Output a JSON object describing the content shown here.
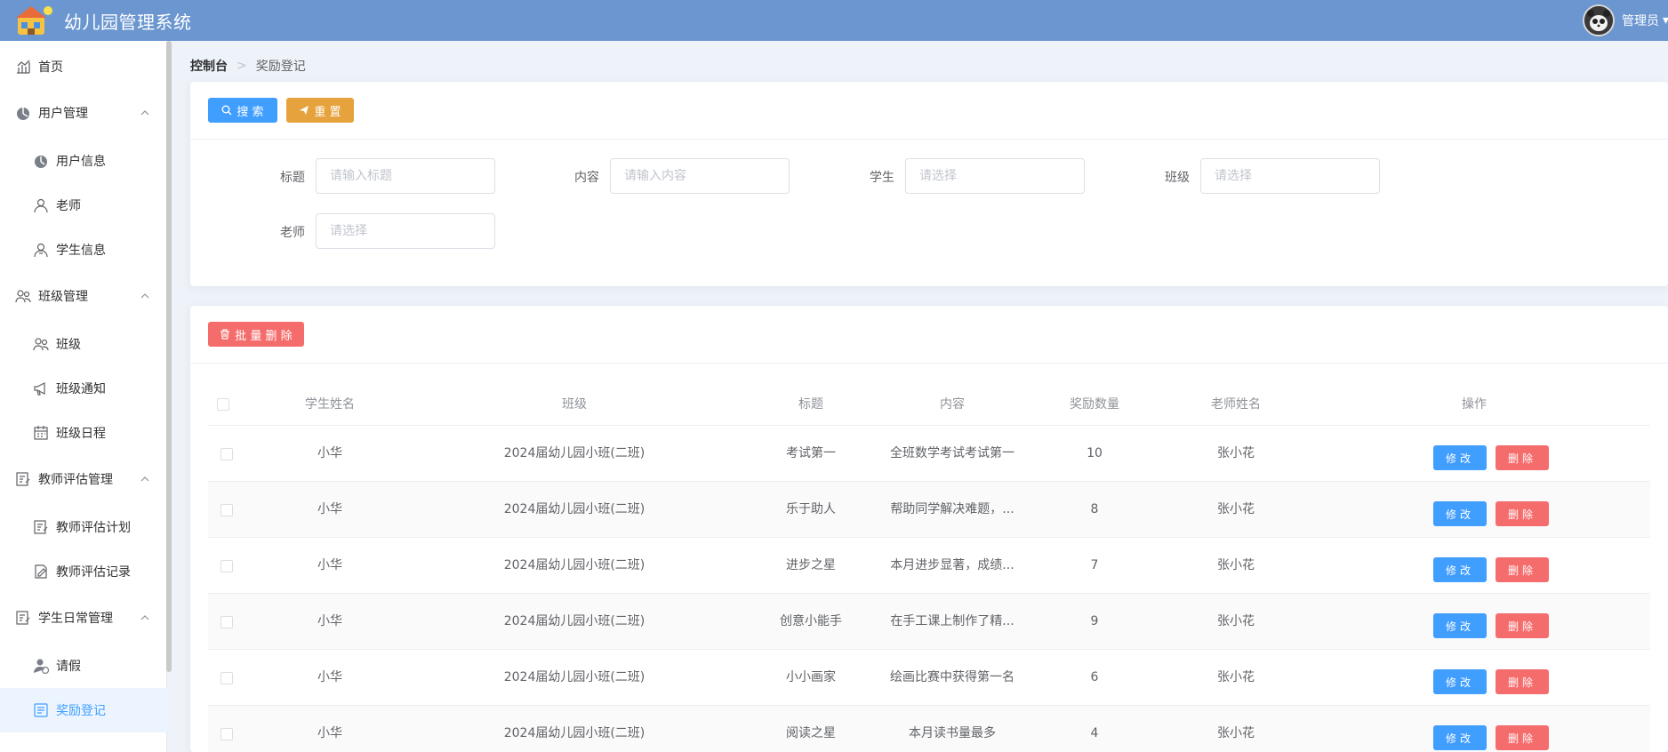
{
  "header": {
    "title": "幼儿园管理系统",
    "user": "管理员",
    "user_caret": "▾"
  },
  "sidebar": {
    "items": [
      {
        "label": "首页",
        "icon": "chart-icon",
        "level": "top"
      },
      {
        "label": "用户管理",
        "icon": "user-group-icon",
        "level": "top",
        "expanded": true
      },
      {
        "label": "用户信息",
        "icon": "user-circle-icon",
        "level": "sub"
      },
      {
        "label": "老师",
        "icon": "teacher-icon",
        "level": "sub"
      },
      {
        "label": "学生信息",
        "icon": "student-icon",
        "level": "sub"
      },
      {
        "label": "班级管理",
        "icon": "class-group-icon",
        "level": "top",
        "expanded": true
      },
      {
        "label": "班级",
        "icon": "class-icon",
        "level": "sub"
      },
      {
        "label": "班级通知",
        "icon": "megaphone-icon",
        "level": "sub"
      },
      {
        "label": "班级日程",
        "icon": "calendar-icon",
        "level": "sub"
      },
      {
        "label": "教师评估管理",
        "icon": "evaluation-icon",
        "level": "top",
        "expanded": true
      },
      {
        "label": "教师评估计划",
        "icon": "evaluation-plan-icon",
        "level": "sub"
      },
      {
        "label": "教师评估记录",
        "icon": "edit-record-icon",
        "level": "sub"
      },
      {
        "label": "学生日常管理",
        "icon": "daily-icon",
        "level": "top",
        "expanded": true
      },
      {
        "label": "请假",
        "icon": "leave-icon",
        "level": "sub"
      },
      {
        "label": "奖励登记",
        "icon": "reward-icon",
        "level": "sub",
        "active": true
      }
    ]
  },
  "breadcrumb": {
    "home": "控制台",
    "separator": ">",
    "current": "奖励登记"
  },
  "search": {
    "search_label": "搜 索",
    "reset_label": "重 置",
    "fields": {
      "title": {
        "label": "标题",
        "placeholder": "请输入标题"
      },
      "content": {
        "label": "内容",
        "placeholder": "请输入内容"
      },
      "student": {
        "label": "学生",
        "placeholder": "请选择"
      },
      "class": {
        "label": "班级",
        "placeholder": "请选择"
      },
      "teacher": {
        "label": "老师",
        "placeholder": "请选择"
      }
    }
  },
  "table": {
    "batch_delete_label": "批 量 删 除",
    "edit_label": "修改",
    "delete_label": "删除",
    "columns": [
      "学生姓名",
      "班级",
      "标题",
      "内容",
      "奖励数量",
      "老师姓名",
      "操作"
    ],
    "rows": [
      {
        "student": "小华",
        "class": "2024届幼儿园小班(二班)",
        "title": "考试第一",
        "content": "全班数学考试考试第一",
        "count": "10",
        "teacher": "张小花"
      },
      {
        "student": "小华",
        "class": "2024届幼儿园小班(二班)",
        "title": "乐于助人",
        "content": "帮助同学解决难题，...",
        "count": "8",
        "teacher": "张小花"
      },
      {
        "student": "小华",
        "class": "2024届幼儿园小班(二班)",
        "title": "进步之星",
        "content": "本月进步显著，成绩...",
        "count": "7",
        "teacher": "张小花"
      },
      {
        "student": "小华",
        "class": "2024届幼儿园小班(二班)",
        "title": "创意小能手",
        "content": "在手工课上制作了精...",
        "count": "9",
        "teacher": "张小花"
      },
      {
        "student": "小华",
        "class": "2024届幼儿园小班(二班)",
        "title": "小小画家",
        "content": "绘画比赛中获得第一名",
        "count": "6",
        "teacher": "张小花"
      },
      {
        "student": "小华",
        "class": "2024届幼儿园小班(二班)",
        "title": "阅读之星",
        "content": "本月读书量最多",
        "count": "4",
        "teacher": "张小花"
      }
    ]
  },
  "colors": {
    "header": "#6b96d0",
    "primary": "#409eff",
    "warning": "#e6a23c",
    "danger": "#f56c6c",
    "active_bg": "#ecf5ff"
  }
}
